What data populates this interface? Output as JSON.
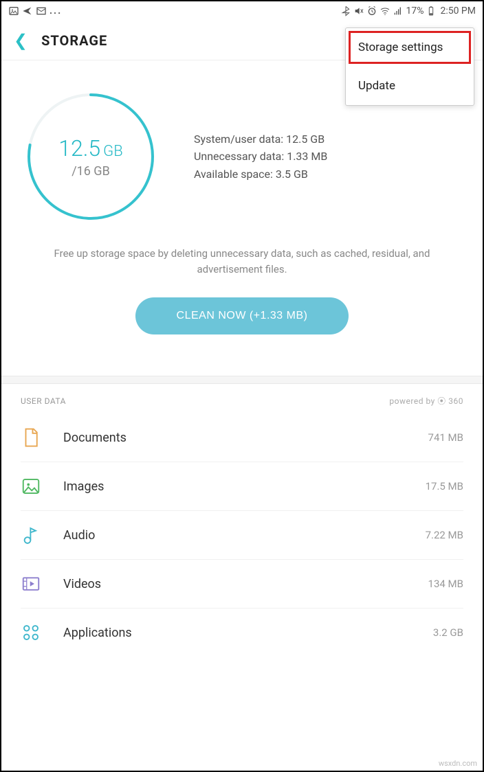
{
  "statusbar": {
    "battery_pct": "17%",
    "time": "2:50 PM"
  },
  "header": {
    "title": "STORAGE"
  },
  "dropdown": {
    "items": [
      "Storage settings",
      "Update"
    ],
    "highlighted_index": 0
  },
  "storage": {
    "used_value": "12.5",
    "used_unit": "GB",
    "total_label": "/16 GB",
    "used_fraction": 0.78,
    "stats": {
      "system": "System/user data: 12.5 GB",
      "unnecessary": "Unnecessary data: 1.33 MB",
      "available": "Available space: 3.5 GB"
    },
    "hint": "Free up storage space by deleting unnecessary data, such as cached, residual, and advertisement files.",
    "clean_button": "CLEAN NOW (+1.33 MB)"
  },
  "user_data": {
    "heading": "USER DATA",
    "powered": "powered by ⦿ 360",
    "items": [
      {
        "icon": "document-icon",
        "label": "Documents",
        "size": "741 MB",
        "color": "#e8a650"
      },
      {
        "icon": "image-icon",
        "label": "Images",
        "size": "17.5 MB",
        "color": "#4fb861"
      },
      {
        "icon": "audio-icon",
        "label": "Audio",
        "size": "7.22 MB",
        "color": "#3fb7cc"
      },
      {
        "icon": "video-icon",
        "label": "Videos",
        "size": "134 MB",
        "color": "#8d7fce"
      },
      {
        "icon": "apps-icon",
        "label": "Applications",
        "size": "3.2 GB",
        "color": "#3fb7cc"
      }
    ]
  },
  "watermark": "wsxdn.com"
}
